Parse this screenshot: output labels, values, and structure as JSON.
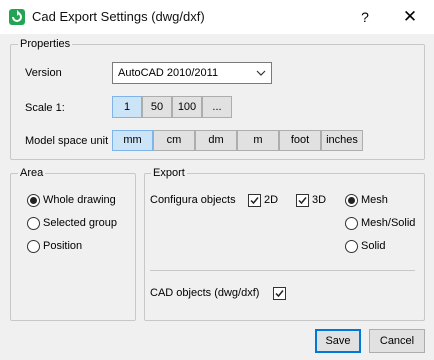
{
  "window": {
    "title": "Cad Export Settings (dwg/dxf)",
    "help": "?",
    "close": "✕",
    "icon": "app-export-icon"
  },
  "properties": {
    "legend": "Properties",
    "version_label": "Version",
    "version_value": "AutoCAD 2010/2011",
    "scale_label": "Scale 1:",
    "scale_options": [
      "1",
      "50",
      "100",
      "..."
    ],
    "scale_selected": "1",
    "unit_label": "Model space unit",
    "unit_options": [
      "mm",
      "cm",
      "dm",
      "m",
      "foot",
      "inches"
    ],
    "unit_selected": "mm"
  },
  "area": {
    "legend": "Area",
    "options": [
      "Whole drawing",
      "Selected group",
      "Position"
    ],
    "selected": "Whole drawing"
  },
  "export": {
    "legend": "Export",
    "configura_label": "Configura objects",
    "check_2d_label": "2D",
    "check_2d": true,
    "check_3d_label": "3D",
    "check_3d": true,
    "mesh_options": [
      "Mesh",
      "Mesh/Solid",
      "Solid"
    ],
    "mesh_selected": "Mesh",
    "cad_objects_label": "CAD objects (dwg/dxf)",
    "cad_objects": true
  },
  "footer": {
    "save": "Save",
    "cancel": "Cancel"
  },
  "colors": {
    "accent_selected": "#cce4f7",
    "default_border": "#0078d7",
    "app_icon": "#23a455"
  }
}
